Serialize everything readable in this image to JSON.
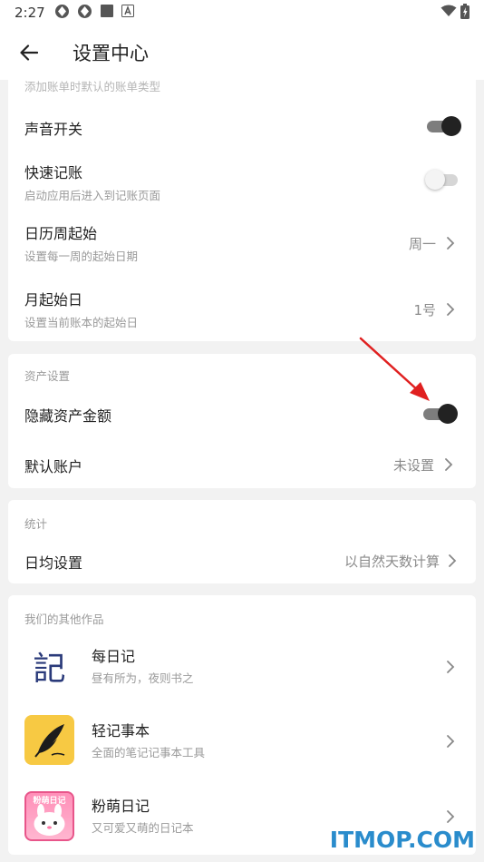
{
  "status_bar": {
    "time": "2:27"
  },
  "header": {
    "title": "设置中心"
  },
  "card_general": {
    "cut_sub": "添加账单时默认的账单类型",
    "rows": [
      {
        "title": "声音开关",
        "toggle": "on"
      },
      {
        "title": "快速记账",
        "subtitle": "启动应用后进入到记账页面",
        "toggle": "off"
      },
      {
        "title": "日历周起始",
        "subtitle": "设置每一周的起始日期",
        "value": "周一"
      },
      {
        "title": "月起始日",
        "subtitle": "设置当前账本的起始日",
        "value": "1号"
      }
    ]
  },
  "card_assets": {
    "section_title": "资产设置",
    "rows": [
      {
        "title": "隐藏资产金额",
        "toggle": "on"
      },
      {
        "title": "默认账户",
        "value": "未设置"
      }
    ]
  },
  "card_stats": {
    "section_title": "统计",
    "rows": [
      {
        "title": "日均设置",
        "value": "以自然天数计算"
      }
    ]
  },
  "card_apps": {
    "section_title": "我们的其他作品",
    "apps": [
      {
        "name": "每日记",
        "desc": "昼有所为，夜则书之",
        "icon_text": "記"
      },
      {
        "name": "轻记事本",
        "desc": "全面的笔记记事本工具",
        "icon": "feather-icon"
      },
      {
        "name": "粉萌日记",
        "desc": "又可爱又萌的日记本",
        "icon_text": "粉萌日记"
      }
    ]
  },
  "watermark": "ITMOP.COM",
  "colors": {
    "annotation_arrow": "#e02020",
    "watermark": "#2a8ccc",
    "toggle_on": "#222222"
  }
}
